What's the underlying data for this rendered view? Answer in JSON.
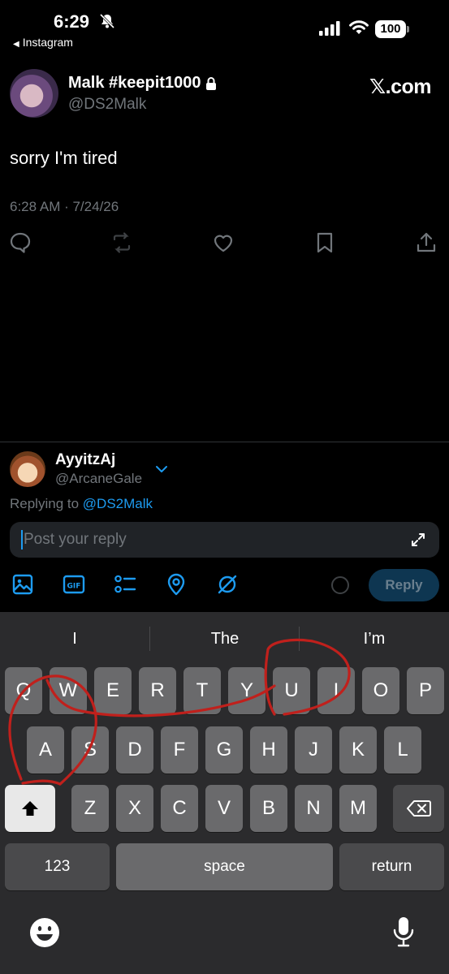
{
  "status_bar": {
    "time": "6:29",
    "back_label": "Instagram",
    "battery": "100"
  },
  "tweet": {
    "display_name": "Malk #keepit1000",
    "handle": "@DS2Malk",
    "brand": "𝕏.com",
    "text": "sorry I'm tired",
    "timestamp": "6:28 AM · 7/24/26"
  },
  "reply": {
    "name": "AyyitzAj",
    "handle": "@ArcaneGale",
    "replying_prefix": "Replying to ",
    "replying_handle": "@DS2Malk",
    "placeholder": "Post your reply",
    "button": "Reply"
  },
  "keyboard": {
    "suggestions": [
      "I",
      "The",
      "I’m"
    ],
    "row1": [
      "Q",
      "W",
      "E",
      "R",
      "T",
      "Y",
      "U",
      "I",
      "O",
      "P"
    ],
    "row2": [
      "A",
      "S",
      "D",
      "F",
      "G",
      "H",
      "J",
      "K",
      "L"
    ],
    "row3": [
      "Z",
      "X",
      "C",
      "V",
      "B",
      "N",
      "M"
    ],
    "numbers_label": "123",
    "space_label": "space",
    "return_label": "return"
  },
  "colors": {
    "accent": "#1d9bf0",
    "annotation": "#c0201c"
  }
}
